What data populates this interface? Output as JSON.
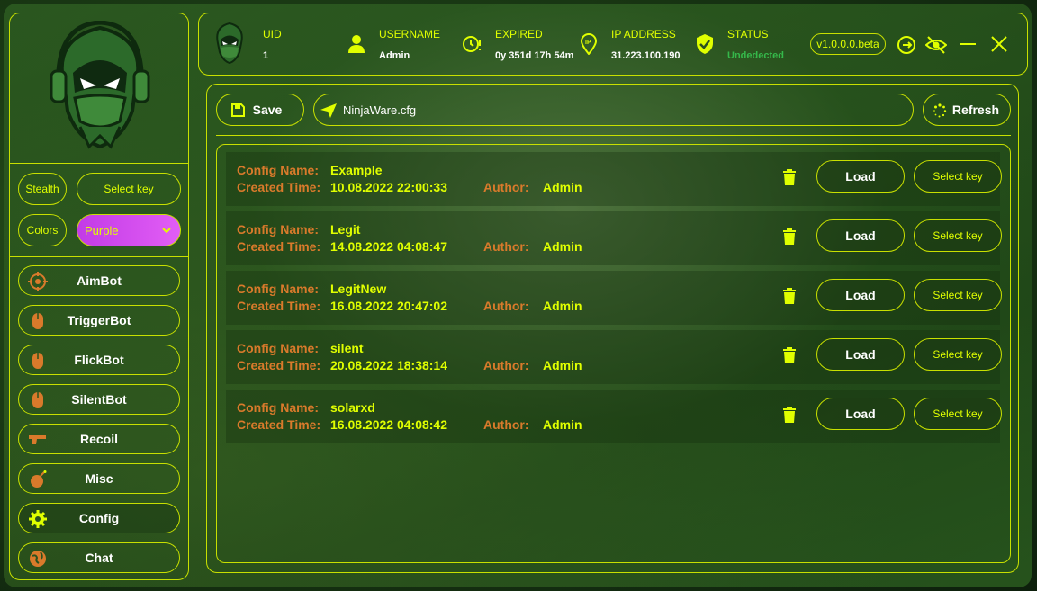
{
  "sidebar": {
    "stealth_label": "Stealth",
    "stealth_key_label": "Select key",
    "colors_label": "Colors",
    "color_value": "Purple",
    "nav": [
      {
        "label": "AimBot",
        "icon": "crosshair-icon"
      },
      {
        "label": "TriggerBot",
        "icon": "mouse-icon"
      },
      {
        "label": "FlickBot",
        "icon": "mouse-icon"
      },
      {
        "label": "SilentBot",
        "icon": "mouse-icon"
      },
      {
        "label": "Recoil",
        "icon": "gun-icon"
      },
      {
        "label": "Misc",
        "icon": "bomb-icon"
      },
      {
        "label": "Config",
        "icon": "gear-icon"
      },
      {
        "label": "Chat",
        "icon": "globe-icon"
      }
    ]
  },
  "header": {
    "uid_title": "UID",
    "uid_value": "1",
    "username_title": "USERNAME",
    "username_value": "Admin",
    "expired_title": "EXPIRED",
    "expired_value": "0y 351d 17h 54m",
    "ip_title": "IP ADDRESS",
    "ip_value": "31.223.100.190",
    "status_title": "STATUS",
    "status_value": "Undedected",
    "version": "v1.0.0.0.beta"
  },
  "toolbar": {
    "save_label": "Save",
    "filename": "NinjaWare.cfg",
    "refresh_label": "Refresh"
  },
  "configs": {
    "config_name_label": "Config Name:",
    "created_time_label": "Created Time:",
    "author_label": "Author:",
    "load_label": "Load",
    "select_key_label": "Select key",
    "items": [
      {
        "name": "Example",
        "time": "10.08.2022 22:00:33",
        "author": "Admin"
      },
      {
        "name": "Legit",
        "time": "14.08.2022 04:08:47",
        "author": "Admin"
      },
      {
        "name": "LegitNew",
        "time": "16.08.2022 20:47:02",
        "author": "Admin"
      },
      {
        "name": "silent",
        "time": "20.08.2022 18:38:14",
        "author": "Admin"
      },
      {
        "name": "solarxd",
        "time": "16.08.2022 04:08:42",
        "author": "Admin"
      }
    ]
  },
  "colors": {
    "accent": "#e0ff00",
    "border": "#c8e000",
    "key_text": "#d97a2b",
    "status_ok": "#35b84a",
    "purple_select": "#d44ff0"
  }
}
